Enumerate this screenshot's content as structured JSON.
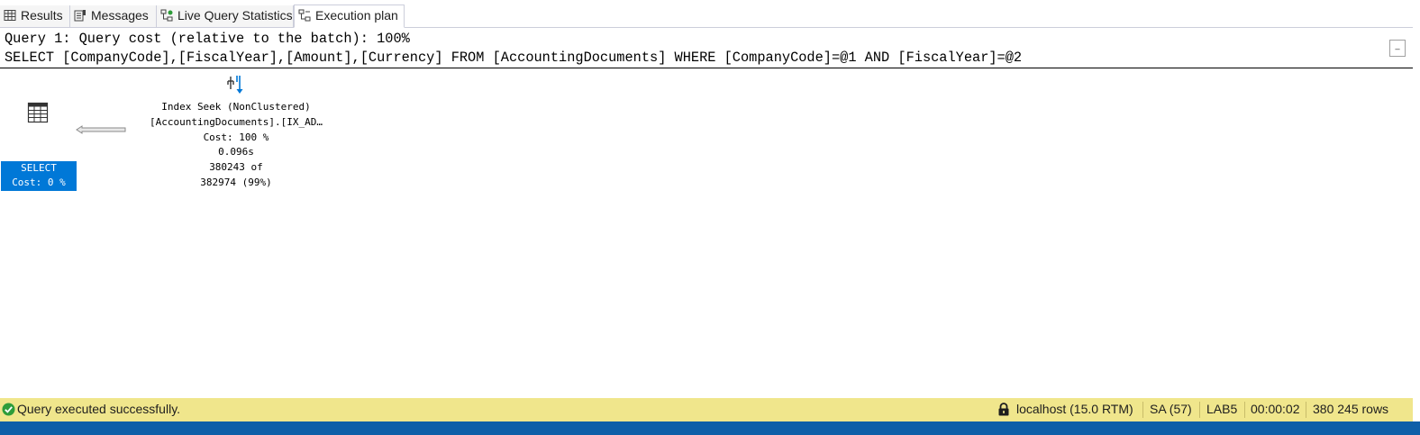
{
  "tabs": [
    {
      "label": "Results",
      "icon": "grid-icon"
    },
    {
      "label": "Messages",
      "icon": "messages-icon"
    },
    {
      "label": "Live Query Statistics",
      "icon": "live-stats-icon"
    },
    {
      "label": "Execution plan",
      "icon": "execution-plan-icon",
      "active": true
    }
  ],
  "query": {
    "header": "Query 1: Query cost (relative to the batch): 100%",
    "sql": "SELECT [CompanyCode],[FiscalYear],[Amount],[Currency] FROM [AccountingDocuments] WHERE [CompanyCode]=@1 AND [FiscalYear]=@2",
    "minimize_glyph": "_"
  },
  "plan": {
    "select_node": {
      "name": "SELECT",
      "cost": "Cost: 0 %",
      "icon": "select-result-icon"
    },
    "seek_node": {
      "icon": "index-seek-icon",
      "line1": "Index Seek (NonClustered)",
      "line2": "[AccountingDocuments].[IX_AD…",
      "cost": "Cost: 100 %",
      "time": "0.096s",
      "rows_actual": "380243 of",
      "rows_estimated": "382974 (99%)"
    }
  },
  "status": {
    "message": "Query executed successfully.",
    "server": "localhost (15.0 RTM)",
    "user": "SA (57)",
    "database": "LAB5",
    "elapsed": "00:00:02",
    "rows": "380 245 rows"
  },
  "colors": {
    "status_bg": "#f0e68c",
    "select_highlight": "#0078d7",
    "bottom_bar": "#0e5fa8",
    "success": "#2e9d3a"
  }
}
